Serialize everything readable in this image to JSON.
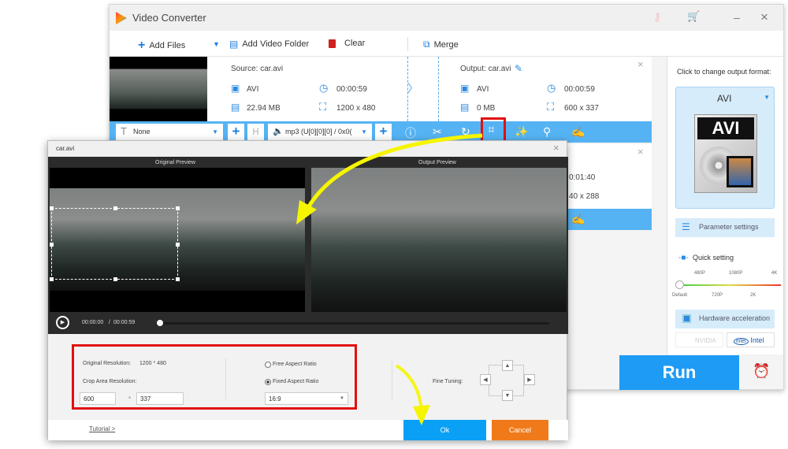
{
  "app": {
    "title": "Video Converter",
    "minimize": "–",
    "close": "×"
  },
  "toolbar": {
    "add_files": "Add Files",
    "add_folder": "Add Video Folder",
    "clear": "Clear",
    "merge": "Merge"
  },
  "file1": {
    "source": "Source: car.avi",
    "src_format": "AVI",
    "src_duration": "00:00:59",
    "src_size": "22.94 MB",
    "src_res": "1200 x 480",
    "output": "Output: car.avi",
    "out_format": "AVI",
    "out_duration": "00:00:59",
    "out_size": "0 MB",
    "out_res": "600 x 337"
  },
  "file_bar": {
    "subtitle": "None",
    "audio": "mp3 (U[0][0][0] / 0x0("
  },
  "file2": {
    "duration_partial": "0:01:40",
    "res_partial": "40 x 288"
  },
  "right_panel": {
    "format_prompt": "Click to change output format:",
    "format": "AVI",
    "param_settings": "Parameter settings",
    "quick_setting": "Quick setting",
    "quality_top": [
      "480P",
      "1080P",
      "4K"
    ],
    "quality_bottom": [
      "Default",
      "720P",
      "2K"
    ],
    "quality_level": 0,
    "hw_accel": "Hardware acceleration",
    "nvidia": "NVIDIA",
    "intel": "Intel",
    "run": "Run"
  },
  "dialog": {
    "title": "car.avi",
    "original_preview": "Original Preview",
    "output_preview": "Output Preview",
    "time_current": "00:00:00",
    "time_sep": "/",
    "time_total": "00:00:59",
    "progress": 0,
    "orig_res_label": "Original Resolution:",
    "orig_res": "1200 * 480",
    "crop_label": "Crop Area Resolution:",
    "crop_w": "600",
    "crop_sep": "*",
    "crop_h": "337",
    "free_ratio": "Free Aspect Ratio",
    "fixed_ratio": "Fixed Aspect Ratio",
    "ratio_value": "16:9",
    "fine_tuning": "Fine Tuning:",
    "tutorial": "Tutorial >",
    "ok": "Ok",
    "cancel": "Cancel"
  },
  "colors": {
    "accent": "#1e9bf5",
    "toolbar_blue": "#55b3f3",
    "cancel": "#f07a1a",
    "highlight": "#e01010",
    "arrow": "#f5f500"
  }
}
